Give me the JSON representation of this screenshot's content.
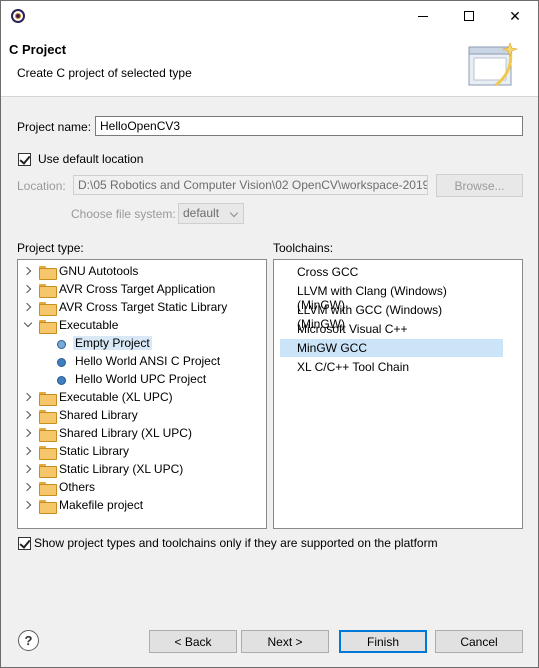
{
  "window": {
    "minimize_glyph": "—",
    "close_glyph": "✕"
  },
  "header": {
    "title": "C Project",
    "description": "Create C project of selected type"
  },
  "form": {
    "project_name_label": "Project name:",
    "project_name_value": "HelloOpenCV3",
    "use_default_location_label": "Use default location",
    "use_default_location_checked": true,
    "location_label": "Location:",
    "location_value": "D:\\05 Robotics and Computer Vision\\02 OpenCV\\workspace-2019",
    "browse_label": "Browse...",
    "file_system_label": "Choose file system:",
    "file_system_value": "default"
  },
  "project_types": {
    "label": "Project type:",
    "items": [
      {
        "label": "GNU Autotools",
        "kind": "folder",
        "expanded": false
      },
      {
        "label": "AVR Cross Target Application",
        "kind": "folder",
        "expanded": false
      },
      {
        "label": "AVR Cross Target Static Library",
        "kind": "folder",
        "expanded": false
      },
      {
        "label": "Executable",
        "kind": "folder",
        "expanded": true
      },
      {
        "label": "Empty Project",
        "kind": "leaf",
        "selected": true
      },
      {
        "label": "Hello World ANSI C Project",
        "kind": "leaf"
      },
      {
        "label": "Hello World UPC Project",
        "kind": "leaf"
      },
      {
        "label": "Executable (XL UPC)",
        "kind": "folder",
        "expanded": false
      },
      {
        "label": "Shared Library",
        "kind": "folder",
        "expanded": false
      },
      {
        "label": "Shared Library (XL UPC)",
        "kind": "folder",
        "expanded": false
      },
      {
        "label": "Static Library",
        "kind": "folder",
        "expanded": false
      },
      {
        "label": "Static Library (XL UPC)",
        "kind": "folder",
        "expanded": false
      },
      {
        "label": "Others",
        "kind": "folder",
        "expanded": false
      },
      {
        "label": "Makefile project",
        "kind": "folder",
        "expanded": false
      }
    ]
  },
  "toolchains": {
    "label": "Toolchains:",
    "items": [
      {
        "label": "Cross GCC"
      },
      {
        "label": "LLVM with Clang (Windows) (MinGW)"
      },
      {
        "label": "LLVM with GCC (Windows) (MinGW)"
      },
      {
        "label": "Microsoft Visual C++"
      },
      {
        "label": "MinGW GCC",
        "selected": true
      },
      {
        "label": "XL C/C++ Tool Chain"
      }
    ]
  },
  "filter_checkbox": {
    "label": "Show project types and toolchains only if they are supported on the platform",
    "checked": true
  },
  "buttons": {
    "help": "?",
    "back": "< Back",
    "next": "Next >",
    "finish": "Finish",
    "cancel": "Cancel"
  },
  "colors": {
    "selection": "#cce4f7",
    "default_button_border": "#0078d7",
    "folder": "#f5c66a"
  }
}
